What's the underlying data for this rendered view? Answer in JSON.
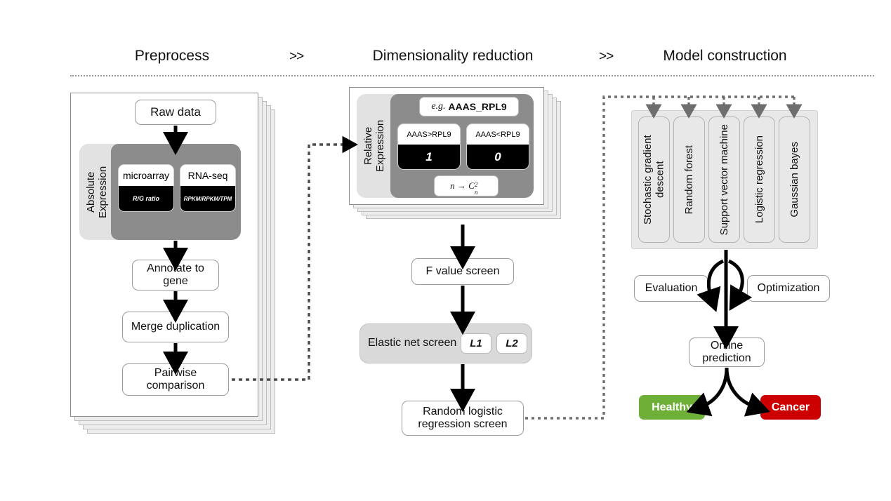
{
  "header": {
    "phases": [
      "Preprocess",
      "Dimensionality reduction",
      "Model construction"
    ],
    "chevron": ">>"
  },
  "preprocess": {
    "raw_data": "Raw data",
    "expression_group_label": "Absolute\nExpression",
    "platforms": [
      {
        "name": "microarray",
        "metric": "R/G ratio"
      },
      {
        "name": "RNA-seq",
        "metric": "RPKM/RPKM/TPM"
      }
    ],
    "steps": [
      "Annotate to gene",
      "Merge duplication",
      "Pairwise comparison"
    ]
  },
  "dimensionality": {
    "expression_group_label": "Relative\nExpression",
    "example_prefix": "e.g.",
    "example_pair": "AAAS_RPL9",
    "comparisons": [
      {
        "rule": "AAAS>RPL9",
        "value": "1"
      },
      {
        "rule": "AAAS<RPL9",
        "value": "0"
      }
    ],
    "combination_formula": "n → C",
    "combination_sup": "2",
    "combination_sub": "n",
    "f_value_screen": "F value screen",
    "elastic_net": {
      "label": "Elastic net screen",
      "penalties": [
        "L1",
        "L2"
      ]
    },
    "random_logistic": "Random logistic regression screen"
  },
  "model": {
    "algorithms": [
      "Stochastic gradient descent",
      "Random forest",
      "Support vector machine",
      "Logistic regression",
      "Gaussian bayes"
    ],
    "evaluation": "Evaluation",
    "optimization": "Optimization",
    "online_prediction": "Online prediction",
    "outcomes": [
      {
        "label": "Healthy",
        "color": "#6EB037"
      },
      {
        "label": "Cancer",
        "color": "#CC0000"
      }
    ]
  },
  "colors": {
    "dark_panel": "#8C8C8C",
    "light_panel": "#E2E2E2",
    "node_border": "#9B9B9B",
    "connector": "#6E6E6E",
    "healthy": "#6EB037",
    "cancer": "#CC0000"
  }
}
